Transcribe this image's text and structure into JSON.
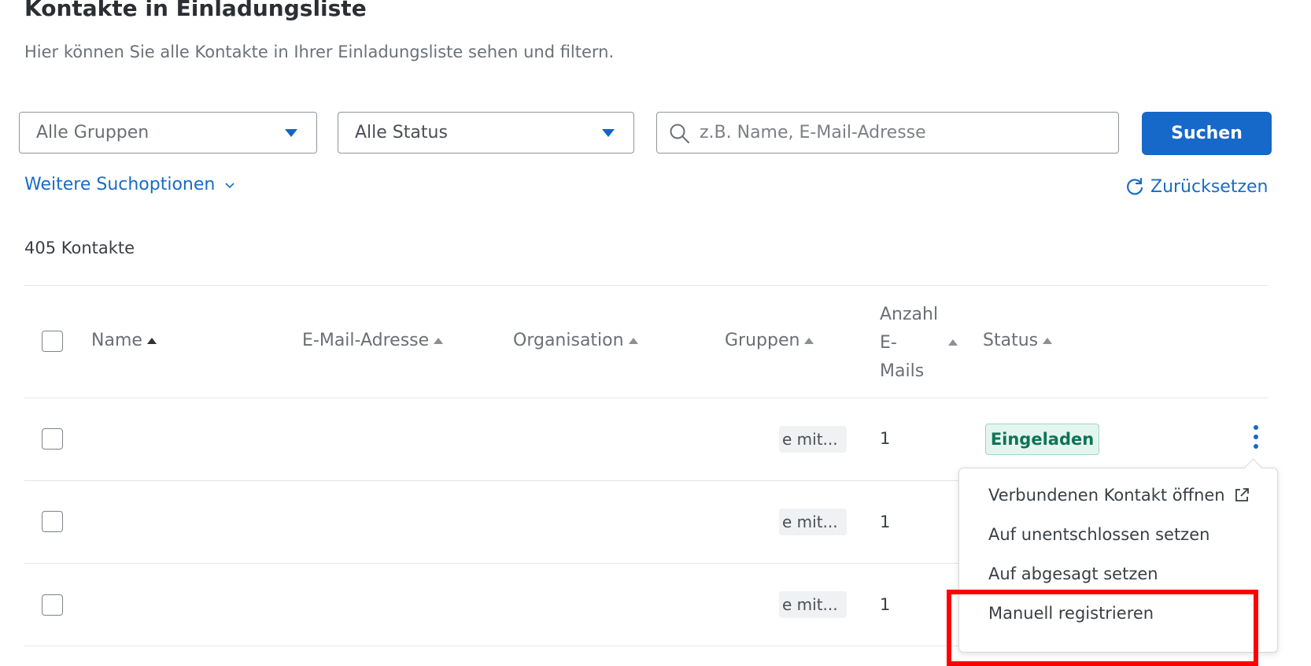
{
  "header": {
    "title": "Kontakte in Einladungsliste",
    "subtitle": "Hier können Sie alle Kontakte in Ihrer Einladungsliste sehen und filtern."
  },
  "filters": {
    "group_select": "Alle Gruppen",
    "status_select": "Alle Status",
    "search_placeholder": "z.B. Name, E-Mail-Adresse",
    "search_value": "",
    "search_button": "Suchen",
    "more_options": "Weitere Suchoptionen",
    "reset": "Zurücksetzen"
  },
  "count_label": "405 Kontakte",
  "table": {
    "columns": {
      "name": "Name",
      "email": "E-Mail-Adresse",
      "organisation": "Organisation",
      "groups": "Gruppen",
      "mail_count_lines": [
        "Anzahl",
        "E-",
        "Mails"
      ],
      "status": "Status"
    },
    "rows": [
      {
        "group_chip": "e mit...",
        "mail_count": "1",
        "status": "Eingeladen"
      },
      {
        "group_chip": "e mit...",
        "mail_count": "1"
      },
      {
        "group_chip": "e mit...",
        "mail_count": "1"
      }
    ]
  },
  "context_menu": {
    "items": [
      "Verbundenen Kontakt öffnen",
      "Auf unentschlossen setzen",
      "Auf abgesagt setzen",
      "Manuell registrieren"
    ]
  },
  "colors": {
    "accent": "#1668c9",
    "badge_bg": "#e3f5ef",
    "badge_text": "#127256",
    "highlight": "#ff0000"
  }
}
